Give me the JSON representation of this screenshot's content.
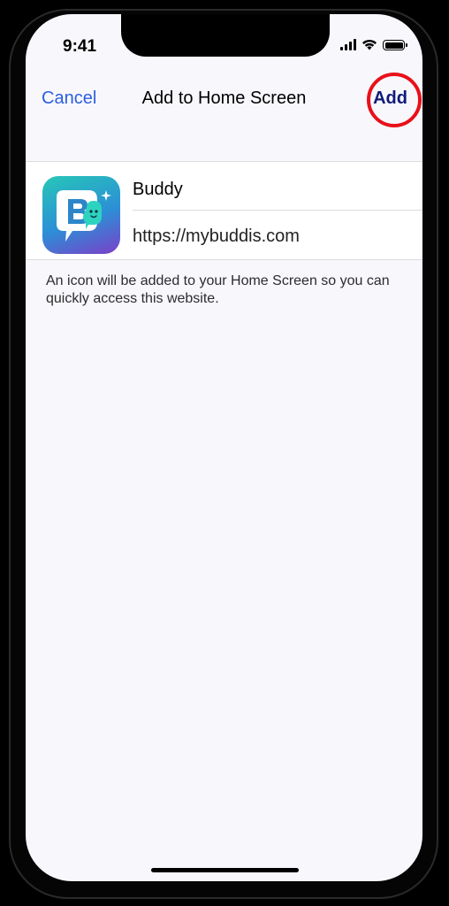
{
  "status_bar": {
    "time": "9:41"
  },
  "nav": {
    "cancel_label": "Cancel",
    "title": "Add to Home Screen",
    "add_label": "Add"
  },
  "form": {
    "app_name": "Buddy",
    "url": "https://mybuddis.com",
    "icon": "buddy-app-icon"
  },
  "hint": "An icon will be added to your Home Screen so you can quickly access this website.",
  "colors": {
    "accent": "#2b5fe0",
    "add_button": "#101a7a",
    "highlight": "#e8101a",
    "background": "#f8f7fc"
  }
}
